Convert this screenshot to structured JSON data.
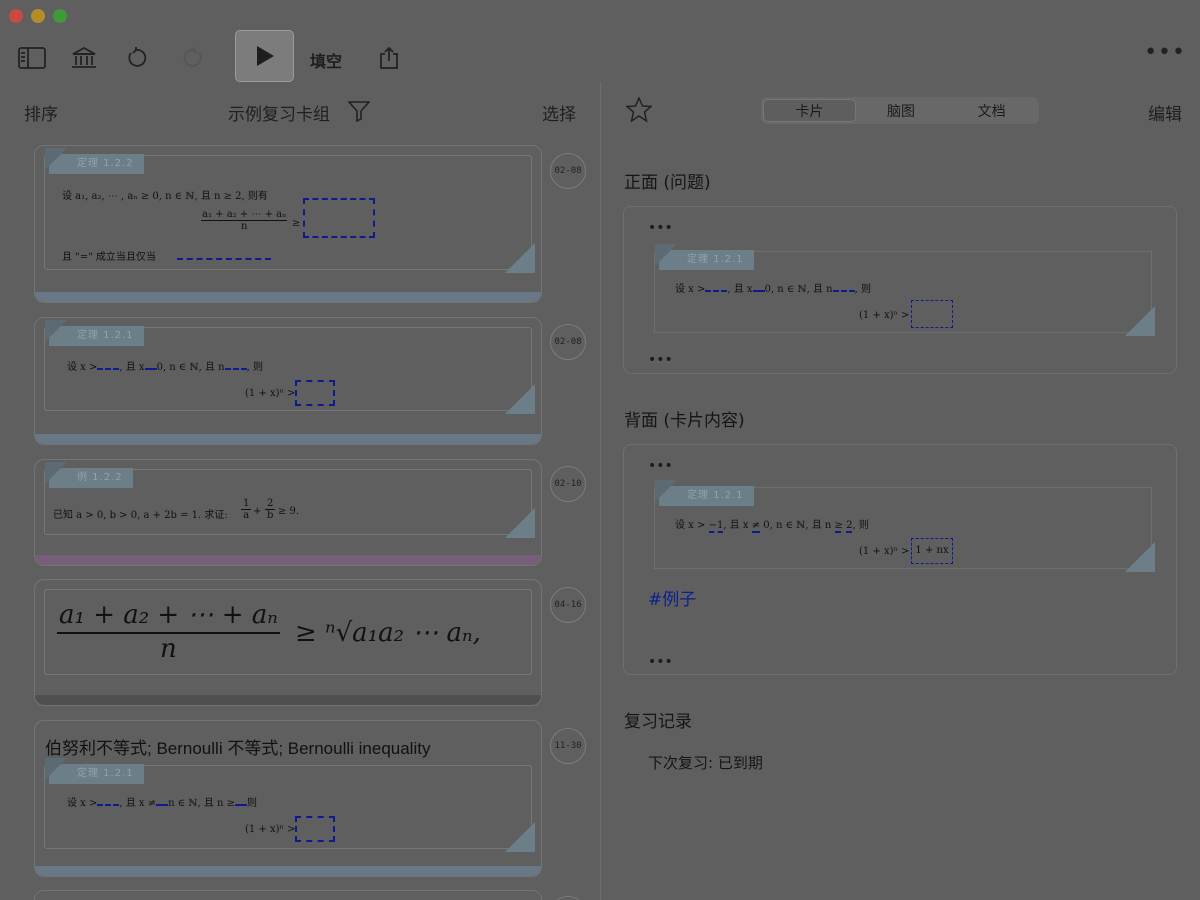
{
  "toolbar": {
    "icons": [
      "sidebar-icon",
      "library-icon",
      "undo-icon",
      "redo-icon",
      "play-icon",
      "share-icon",
      "more-icon"
    ],
    "cloze_label": "填空",
    "more_label": "•••"
  },
  "left": {
    "sort_label": "排序",
    "deck_title": "示例复习卡组",
    "select_label": "选择",
    "cards": [
      {
        "date": "02-08",
        "theorem_tag": "定理 1.2.2",
        "line1": "设 a₁, a₂, ⋯ , aₙ ≥ 0, n ∈ ℕ, 且 n ≥ 2, 则有",
        "formula": "a₁ + a₂ + ⋯ + aₙ",
        "formula_den": "n",
        "line3": "且 \"=\" 成立当且仅当",
        "bar_color": "#6a7787"
      },
      {
        "date": "02-08",
        "theorem_tag": "定理 1.2.1",
        "line1a": "设 x >",
        "line1b": ", 且 x",
        "line1c": "0, n ∈ ℕ, 且 n",
        "line1d": ", 则",
        "formula": "(1 + x)ⁿ >",
        "bar_color": "#6a7787"
      },
      {
        "date": "02-10",
        "theorem_tag": "例 1.2.2",
        "line1": "已知 a > 0, b > 0, a + 2b = 1. 求证: ",
        "frac1_num": "1",
        "frac1_den": "a",
        "frac2_num": "2",
        "frac2_den": "b",
        "tail": "≥ 9.",
        "bar_color": "#775f79"
      },
      {
        "date": "04-16",
        "num": "a₁ + a₂ + ⋯ + aₙ",
        "den": "n",
        "rhs": "≥ ⁿ√a₁a₂ ⋯ aₙ,",
        "bar_color": "#4f4f4f"
      },
      {
        "date": "11-30",
        "title": "伯努利不等式; Bernoulli 不等式; Bernoulli inequality",
        "theorem_tag": "定理 1.2.1",
        "line1a": "设 x >",
        "line1b": ", 且 x ≠",
        "line1c": "n ∈ ℕ, 且 n ≥",
        "line1d": "则",
        "formula": "(1 + x)ⁿ >",
        "bar_color": "#6a7787"
      }
    ]
  },
  "right": {
    "tabs": [
      "卡片",
      "脑图",
      "文档"
    ],
    "active_tab": "卡片",
    "edit_label": "编辑",
    "front_title": "正面 (问题)",
    "back_title": "背面 (卡片内容)",
    "dots": "•••",
    "front_card": {
      "theorem_tag": "定理 1.2.1",
      "line1a": "设 x >",
      "line1b": ", 且 x",
      "line1c": "0, n ∈ ℕ, 且 n",
      "line1d": ", 则",
      "formula": "(1 + x)ⁿ >"
    },
    "back_card": {
      "theorem_tag": "定理 1.2.1",
      "line1a": "设 x >",
      "ans1": "−1",
      "line1b": ", 且 x",
      "ans2": "≠",
      "line1c": "0, n ∈ ℕ, 且 n",
      "ans3": "≥ 2",
      "line1d": ", 则",
      "formula": "(1 + x)ⁿ >",
      "ans4": "1 + nx"
    },
    "tag": "#例子",
    "review_title": "复习记录",
    "next_review": "下次复习: 已到期"
  }
}
